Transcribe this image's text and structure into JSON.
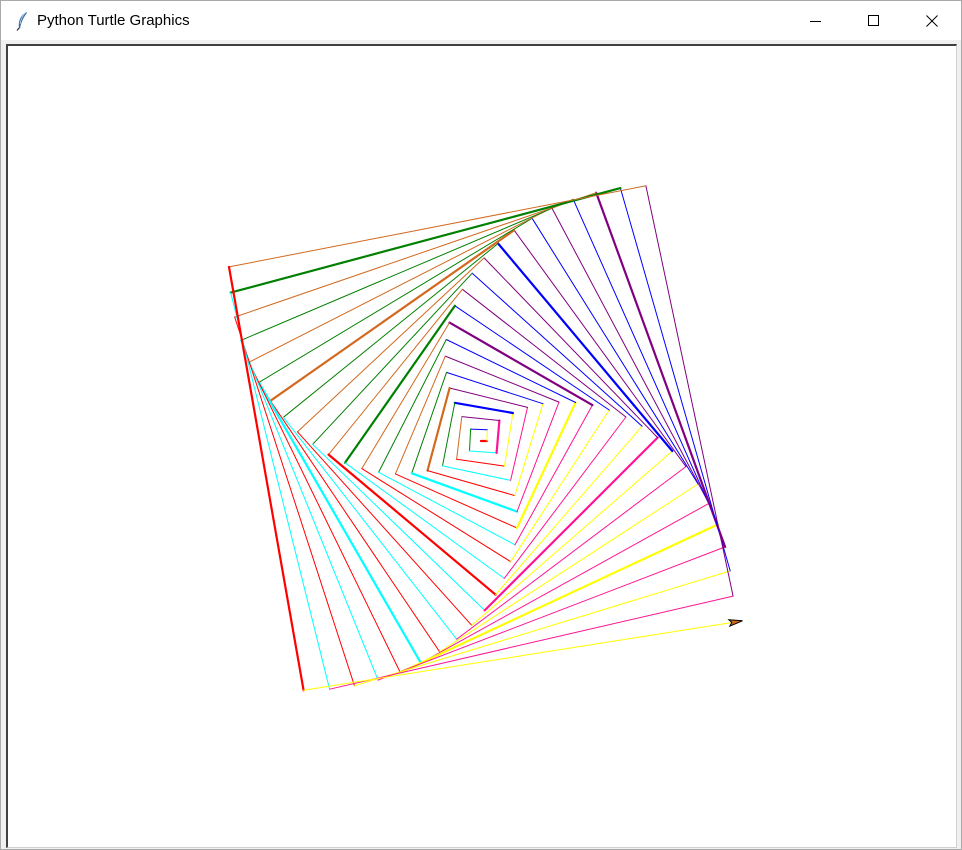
{
  "window": {
    "title": "Python Turtle Graphics",
    "icon": "feather-icon",
    "controls": [
      "minimize-icon",
      "maximize-icon",
      "close-icon"
    ]
  },
  "canvas": {
    "background": "#ffffff",
    "pen_colors": [
      "#ff0000",
      "#ffff00",
      "#0000ff",
      "#008000",
      "#00ffff",
      "#ff1493",
      "#800080",
      "#d2691e"
    ],
    "turtle_color": "#000000",
    "turtle_fill": "#d2691e"
  }
}
